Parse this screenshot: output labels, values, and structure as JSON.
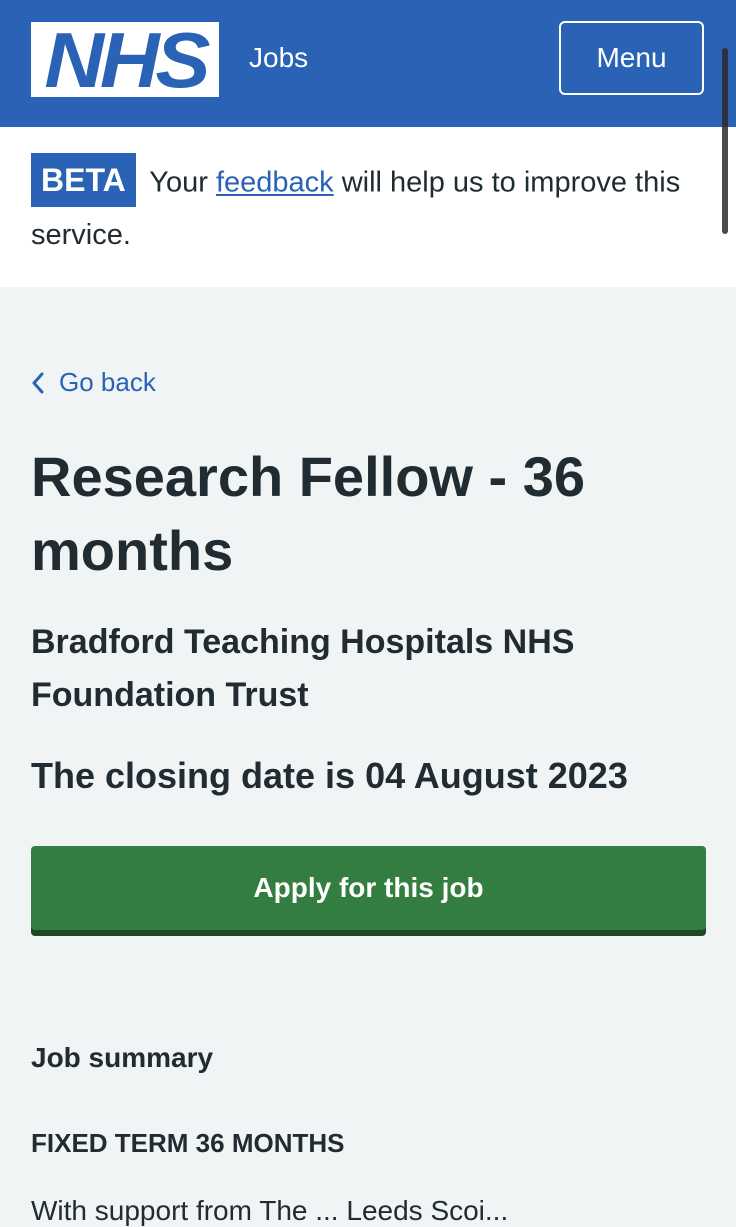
{
  "header": {
    "logo_text": "NHS",
    "service_name": "Jobs",
    "menu_label": "Menu"
  },
  "beta_banner": {
    "tag": "BETA",
    "text_before": "Your",
    "link_text": "feedback",
    "text_after": "will help us to improve this service."
  },
  "back_link": {
    "label": "Go back",
    "icon": "chevron-left-icon"
  },
  "job": {
    "title": "Research Fellow - 36 months",
    "employer": "Bradford Teaching Hospitals NHS Foundation Trust",
    "closing_date_text": "The closing date is 04 August 2023",
    "apply_label": "Apply for this job"
  },
  "summary": {
    "heading": "Job summary",
    "subheading": "FIXED TERM 36 MONTHS",
    "partial_text": "With support from The ... Leeds Scoi..."
  },
  "colors": {
    "nhs_blue": "#2a62b5",
    "page_background": "#f0f4f5",
    "button_green": "#347d40",
    "text": "#212b32"
  }
}
